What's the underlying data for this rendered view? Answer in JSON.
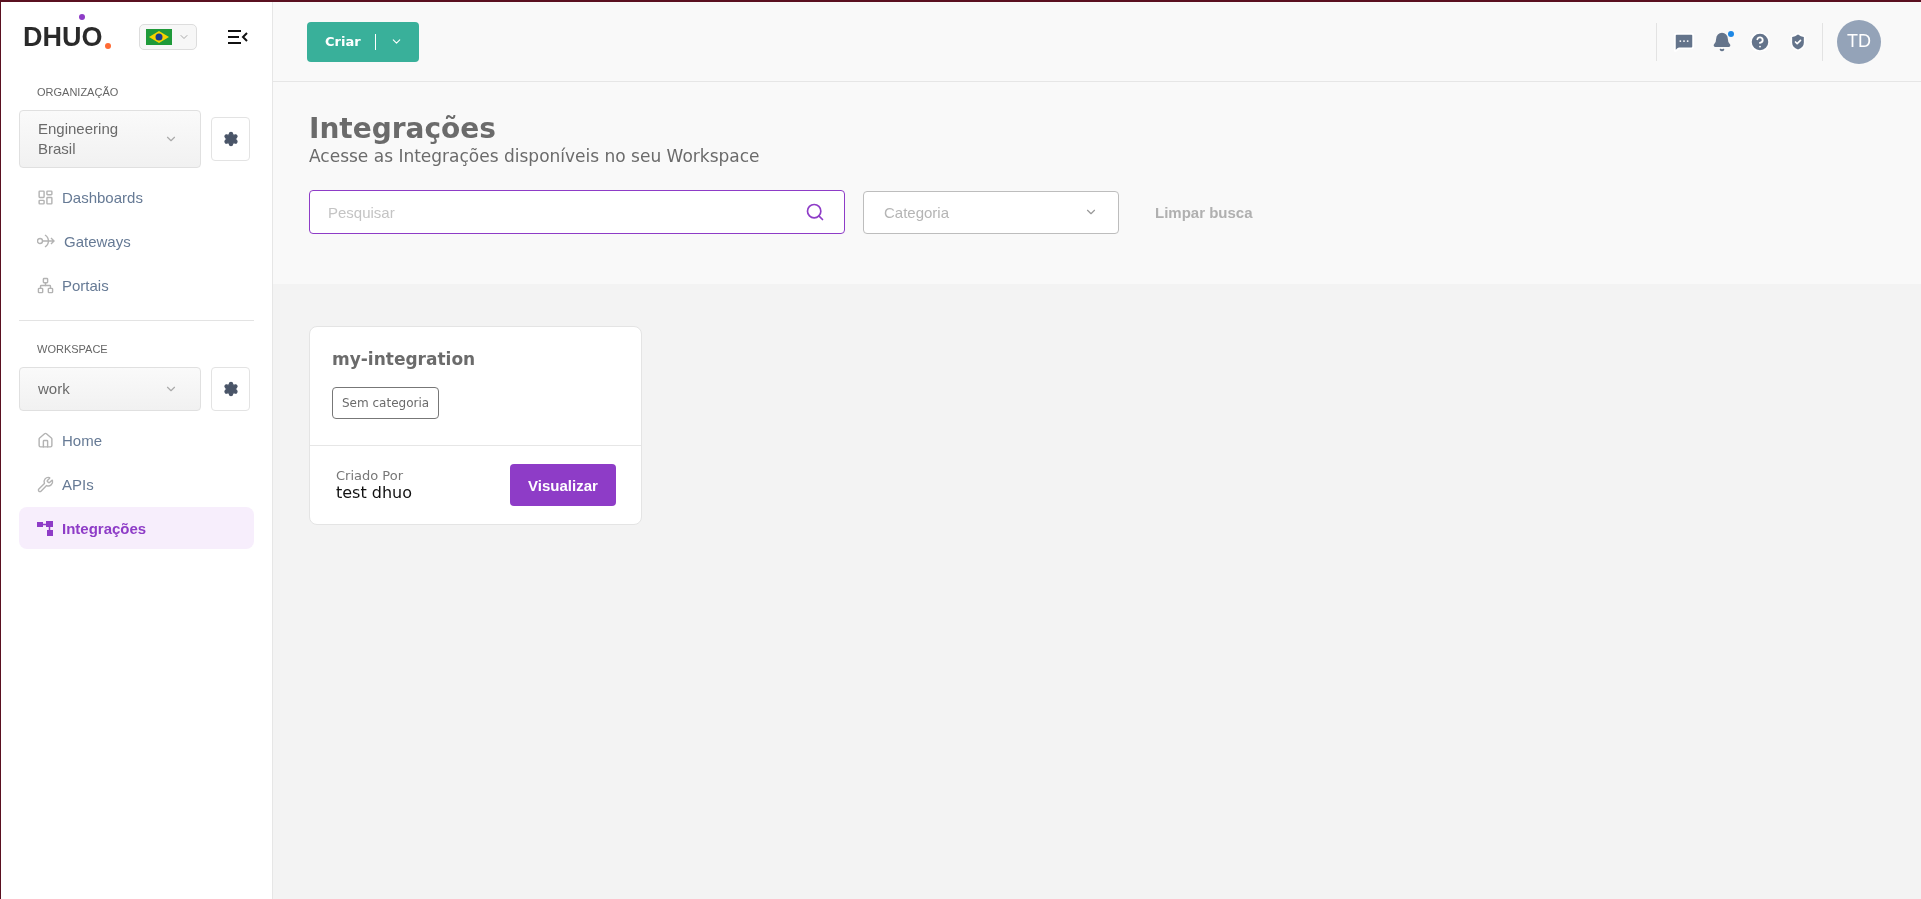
{
  "sidebar": {
    "logo": "DHUO",
    "organization": {
      "label": "ORGANIZAÇÃO",
      "value": "Engineering Brasil",
      "items": [
        {
          "label": "Dashboards",
          "selected": false
        },
        {
          "label": "Gateways",
          "selected": false
        },
        {
          "label": "Portais",
          "selected": false
        }
      ]
    },
    "workspace": {
      "label": "WORKSPACE",
      "value": "work",
      "items": [
        {
          "label": "Home",
          "selected": false
        },
        {
          "label": "APIs",
          "selected": false
        },
        {
          "label": "Integrações",
          "selected": true
        }
      ]
    }
  },
  "header": {
    "create_button": "Criar",
    "notifications_unread": true,
    "avatar": "TD"
  },
  "page": {
    "title": "Integrações",
    "subtitle": "Acesse as Integrações disponíveis no seu Workspace",
    "search": {
      "placeholder": "Pesquisar"
    },
    "category": {
      "placeholder": "Categoria"
    },
    "clear": "Limpar busca"
  },
  "cards": [
    {
      "title": "my-integration",
      "tag": "Sem categoria",
      "created_by_label": "Criado Por",
      "created_by": "test dhuo",
      "action": "Visualizar"
    }
  ]
}
